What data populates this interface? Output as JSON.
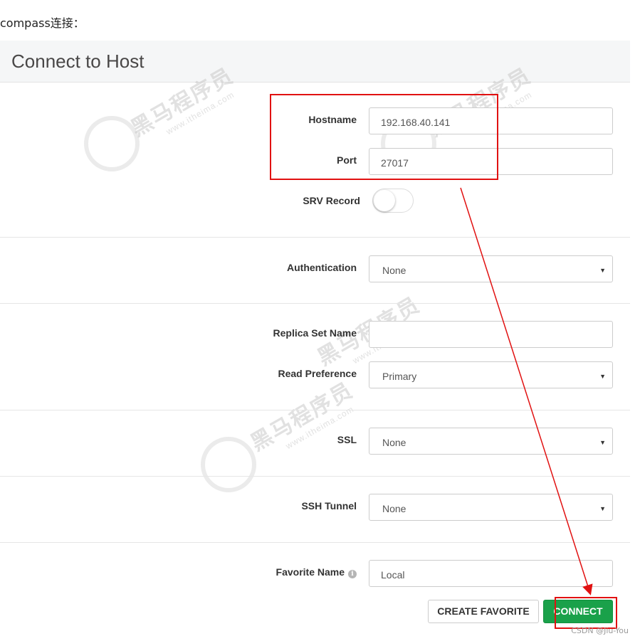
{
  "caption": "compass连接：",
  "header": {
    "title": "Connect to Host"
  },
  "watermark": {
    "brand": "黑马程序员",
    "site": "www.itheima.com"
  },
  "fields": {
    "hostname": {
      "label": "Hostname",
      "value": "192.168.40.141"
    },
    "port": {
      "label": "Port",
      "value": "27017"
    },
    "srv": {
      "label": "SRV Record",
      "on": false
    },
    "authentication": {
      "label": "Authentication",
      "value": "None"
    },
    "replica_set": {
      "label": "Replica Set Name",
      "value": ""
    },
    "read_preference": {
      "label": "Read Preference",
      "value": "Primary"
    },
    "ssl": {
      "label": "SSL",
      "value": "None"
    },
    "ssh_tunnel": {
      "label": "SSH Tunnel",
      "value": "None"
    },
    "favorite_name": {
      "label": "Favorite Name",
      "value": "Local",
      "info_icon": "info-circle-icon"
    }
  },
  "buttons": {
    "create_favorite": "CREATE FAVORITE",
    "connect": "CONNECT"
  },
  "credit": "CSDN @Jiu-You",
  "colors": {
    "annotation_red": "#e11111",
    "connect_green": "#1aa14a"
  },
  "icons": {
    "caret": "caret-down-icon"
  }
}
